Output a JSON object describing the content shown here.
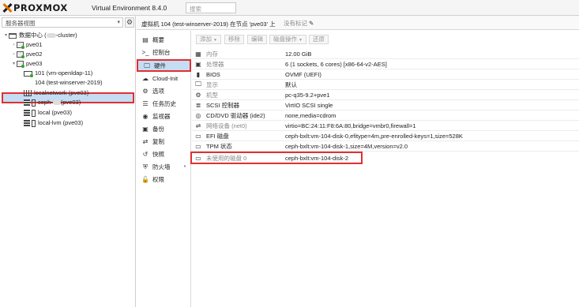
{
  "topbar": {
    "brand": "PROXMOX",
    "version": "Virtual Environment 8.4.0",
    "search_placeholder": "搜索"
  },
  "sidebar": {
    "view": "服务器视图",
    "tree": [
      {
        "label": "数据中心 (",
        "suffix": "-cluster)",
        "icon": "datacenter-icon"
      },
      {
        "label": "pve01",
        "icon": "server-icon"
      },
      {
        "label": "pve02",
        "icon": "server-icon"
      },
      {
        "label": "pve03",
        "icon": "server-icon"
      },
      {
        "label": "101 (vm-openldap-11)",
        "icon": "vm-icon"
      },
      {
        "label": "104 (test-winserver-2019)",
        "icon": "vm-icon",
        "selected": true
      },
      {
        "label": "localnetwork (pve03)",
        "icon": "network-icon"
      },
      {
        "label": "ceph-",
        "suffix": " (pve03)",
        "icon": "storage-icon"
      },
      {
        "label": "local (pve03)",
        "icon": "storage-icon"
      },
      {
        "label": "local-lvm (pve03)",
        "icon": "storage-icon"
      }
    ]
  },
  "header": {
    "title": "虚拟机 104 (test-winserver-2019) 在节点 'pve03' 上",
    "tag_label": "没有标记"
  },
  "menu": [
    {
      "label": "概要",
      "icon": "summary-icon"
    },
    {
      "label": "控制台",
      "icon": "console-icon"
    },
    {
      "label": "硬件",
      "icon": "monitor-icon",
      "active": true
    },
    {
      "label": "Cloud-Init",
      "icon": "cloud-icon"
    },
    {
      "label": "选项",
      "icon": "options-gear-icon"
    },
    {
      "label": "任务历史",
      "icon": "list-icon"
    },
    {
      "label": "监视器",
      "icon": "eye-icon"
    },
    {
      "label": "备份",
      "icon": "floppy-icon"
    },
    {
      "label": "复制",
      "icon": "retweet-icon"
    },
    {
      "label": "快照",
      "icon": "history-icon"
    },
    {
      "label": "防火墙",
      "icon": "shield-icon",
      "expandable": true
    },
    {
      "label": "权限",
      "icon": "unlock-icon"
    }
  ],
  "toolbar": {
    "add": "添加",
    "remove": "移除",
    "edit": "编辑",
    "disk_action": "磁盘操作",
    "revert": "还原"
  },
  "hardware": [
    {
      "key": "内存",
      "value": "12.00 GiB",
      "icon": "memory-icon",
      "dim": true
    },
    {
      "key": "处理器",
      "value": "6 (1 sockets, 6 cores) [x86-64-v2-AES]",
      "icon": "cpu-icon",
      "dim": true
    },
    {
      "key": "BIOS",
      "value": "OVMF (UEFI)",
      "icon": "bios-icon"
    },
    {
      "key": "显示",
      "value": "默认",
      "icon": "display-icon",
      "dim": true
    },
    {
      "key": "机型",
      "value": "pc-q35-9.2+pve1",
      "icon": "machine-gears-icon",
      "dim": true
    },
    {
      "key": "SCSI 控制器",
      "value": "VirtIO SCSI single",
      "icon": "database-icon"
    },
    {
      "key": "CD/DVD 驱动器 (ide2)",
      "value": "none,media=cdrom",
      "icon": "cdrom-icon"
    },
    {
      "key": "网络设备 (net0)",
      "value": "virtio=BC:24:11:F8:6A:80,bridge=vmbr0,firewall=1",
      "icon": "network-icon",
      "dim": true
    },
    {
      "key": "EFI 磁盘",
      "value": "ceph-bxlt:vm-104-disk-0,efitype=4m,pre-enrolled-keys=1,size=528K",
      "icon": "hdd-icon"
    },
    {
      "key": "TPM 状态",
      "value": "ceph-bxlt:vm-104-disk-1,size=4M,version=v2.0",
      "icon": "hdd-icon"
    },
    {
      "key": "未使用的磁盘 0",
      "value": "ceph-bxlt:vm-104-disk-2",
      "icon": "hdd-icon",
      "dim": true,
      "highlighted": true
    }
  ]
}
